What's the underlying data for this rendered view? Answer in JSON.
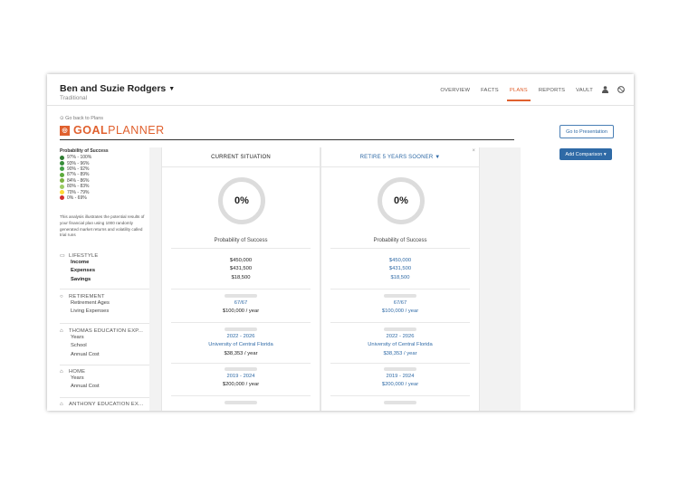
{
  "header": {
    "client_name": "Ben and Suzie Rodgers",
    "client_caret": "▼",
    "client_subtitle": "Traditional",
    "nav": [
      "OVERVIEW",
      "FACTS",
      "PLANS",
      "REPORTS",
      "VAULT"
    ],
    "nav_active": "PLANS"
  },
  "planner": {
    "back_link": "Go back to Plans",
    "title_bold": "GOAL",
    "title_light": "PLANNER",
    "go_to_presentation": "Go to Presentation",
    "add_comparison": "Add Comparison ▾"
  },
  "legend": {
    "title": "Probability of Success",
    "items": [
      {
        "label": "97% - 100%",
        "color": "#2e7d32"
      },
      {
        "label": "93% - 96%",
        "color": "#388e3c"
      },
      {
        "label": "90% - 92%",
        "color": "#43a047"
      },
      {
        "label": "87% - 89%",
        "color": "#5cab3d"
      },
      {
        "label": "84% - 86%",
        "color": "#7cb342"
      },
      {
        "label": "80% - 83%",
        "color": "#9ccc65"
      },
      {
        "label": "70% - 79%",
        "color": "#fdd835"
      },
      {
        "label": "0% - 69%",
        "color": "#d32f2f"
      }
    ],
    "analysis": "This analysis illustrates the potential results of your financial plan using 1000 randomly generated market returns and volatility called trial runs"
  },
  "sections": {
    "lifestyle": {
      "title": "LIFESTYLE",
      "rows": [
        "Income",
        "Expenses",
        "Savings"
      ]
    },
    "retirement": {
      "title": "RETIREMENT",
      "rows": [
        "Retirement Ages",
        "Living Expenses"
      ]
    },
    "thomas": {
      "title": "THOMAS EDUCATION EXP...",
      "rows": [
        "Years",
        "School",
        "Annual Cost"
      ]
    },
    "home": {
      "title": "HOME",
      "rows": [
        "Years",
        "Annual Cost"
      ]
    },
    "anthony": {
      "title": "ANTHONY EDUCATION EX..."
    }
  },
  "columns": [
    {
      "title": "CURRENT SITUATION",
      "probability": "0%",
      "probability_label": "Probability of Success",
      "income": "$450,000",
      "expenses": "$431,500",
      "savings": "$18,500",
      "retirement_ages": "67/67",
      "living_expenses": "$100,000 / year",
      "thomas_years": "2022 - 2026",
      "thomas_school": "University of Central Florida",
      "thomas_cost": "$38,353 / year",
      "home_years": "2019 - 2024",
      "home_cost": "$200,000 / year"
    },
    {
      "title": "RETIRE 5 YEARS SOONER ▼",
      "probability": "0%",
      "probability_label": "Probability of Success",
      "income": "$450,000",
      "expenses": "$431,500",
      "savings": "$18,500",
      "retirement_ages": "67/67",
      "living_expenses": "$100,000 / year",
      "thomas_years": "2022 - 2026",
      "thomas_school": "University of Central Florida",
      "thomas_cost": "$38,353 / year",
      "home_years": "2019 - 2024",
      "home_cost": "$200,000 / year",
      "close": "×"
    }
  ],
  "colors": {
    "accent": "#e0602e",
    "link": "#2f6aa6"
  }
}
